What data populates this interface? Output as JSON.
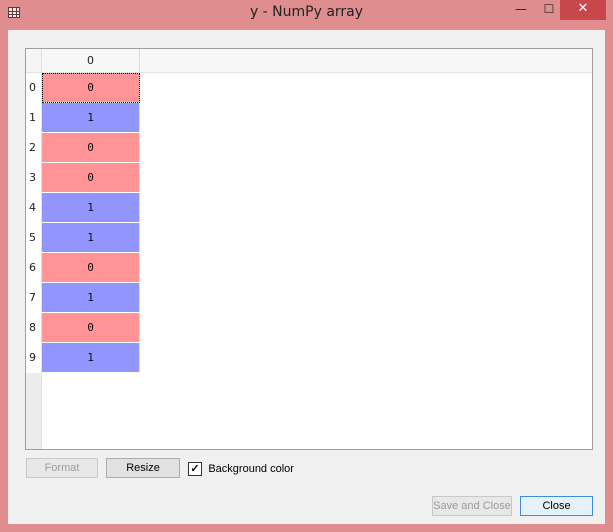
{
  "window": {
    "title": "y - NumPy array",
    "icons": {
      "app": "table-icon",
      "minimize": "minimize-icon",
      "maximize": "maximize-icon",
      "close": "close-icon"
    },
    "glyphs": {
      "minimize": "—",
      "maximize": "☐",
      "close": "✕"
    }
  },
  "grid": {
    "column_header": "0",
    "rows": [
      {
        "index": "0",
        "value": "0",
        "color": "#ff9396"
      },
      {
        "index": "1",
        "value": "1",
        "color": "#9395ff"
      },
      {
        "index": "2",
        "value": "0",
        "color": "#ff9396"
      },
      {
        "index": "3",
        "value": "0",
        "color": "#ff9396"
      },
      {
        "index": "4",
        "value": "1",
        "color": "#9395ff"
      },
      {
        "index": "5",
        "value": "1",
        "color": "#9395ff"
      },
      {
        "index": "6",
        "value": "0",
        "color": "#ff9396"
      },
      {
        "index": "7",
        "value": "1",
        "color": "#9395ff"
      },
      {
        "index": "8",
        "value": "0",
        "color": "#ff9396"
      },
      {
        "index": "9",
        "value": "1",
        "color": "#9395ff"
      }
    ]
  },
  "controls": {
    "format_label": "Format",
    "resize_label": "Resize",
    "background_color_label": "Background color",
    "background_color_checked": true,
    "check_glyph": "✓",
    "save_and_close_label": "Save and Close",
    "close_label": "Close"
  }
}
